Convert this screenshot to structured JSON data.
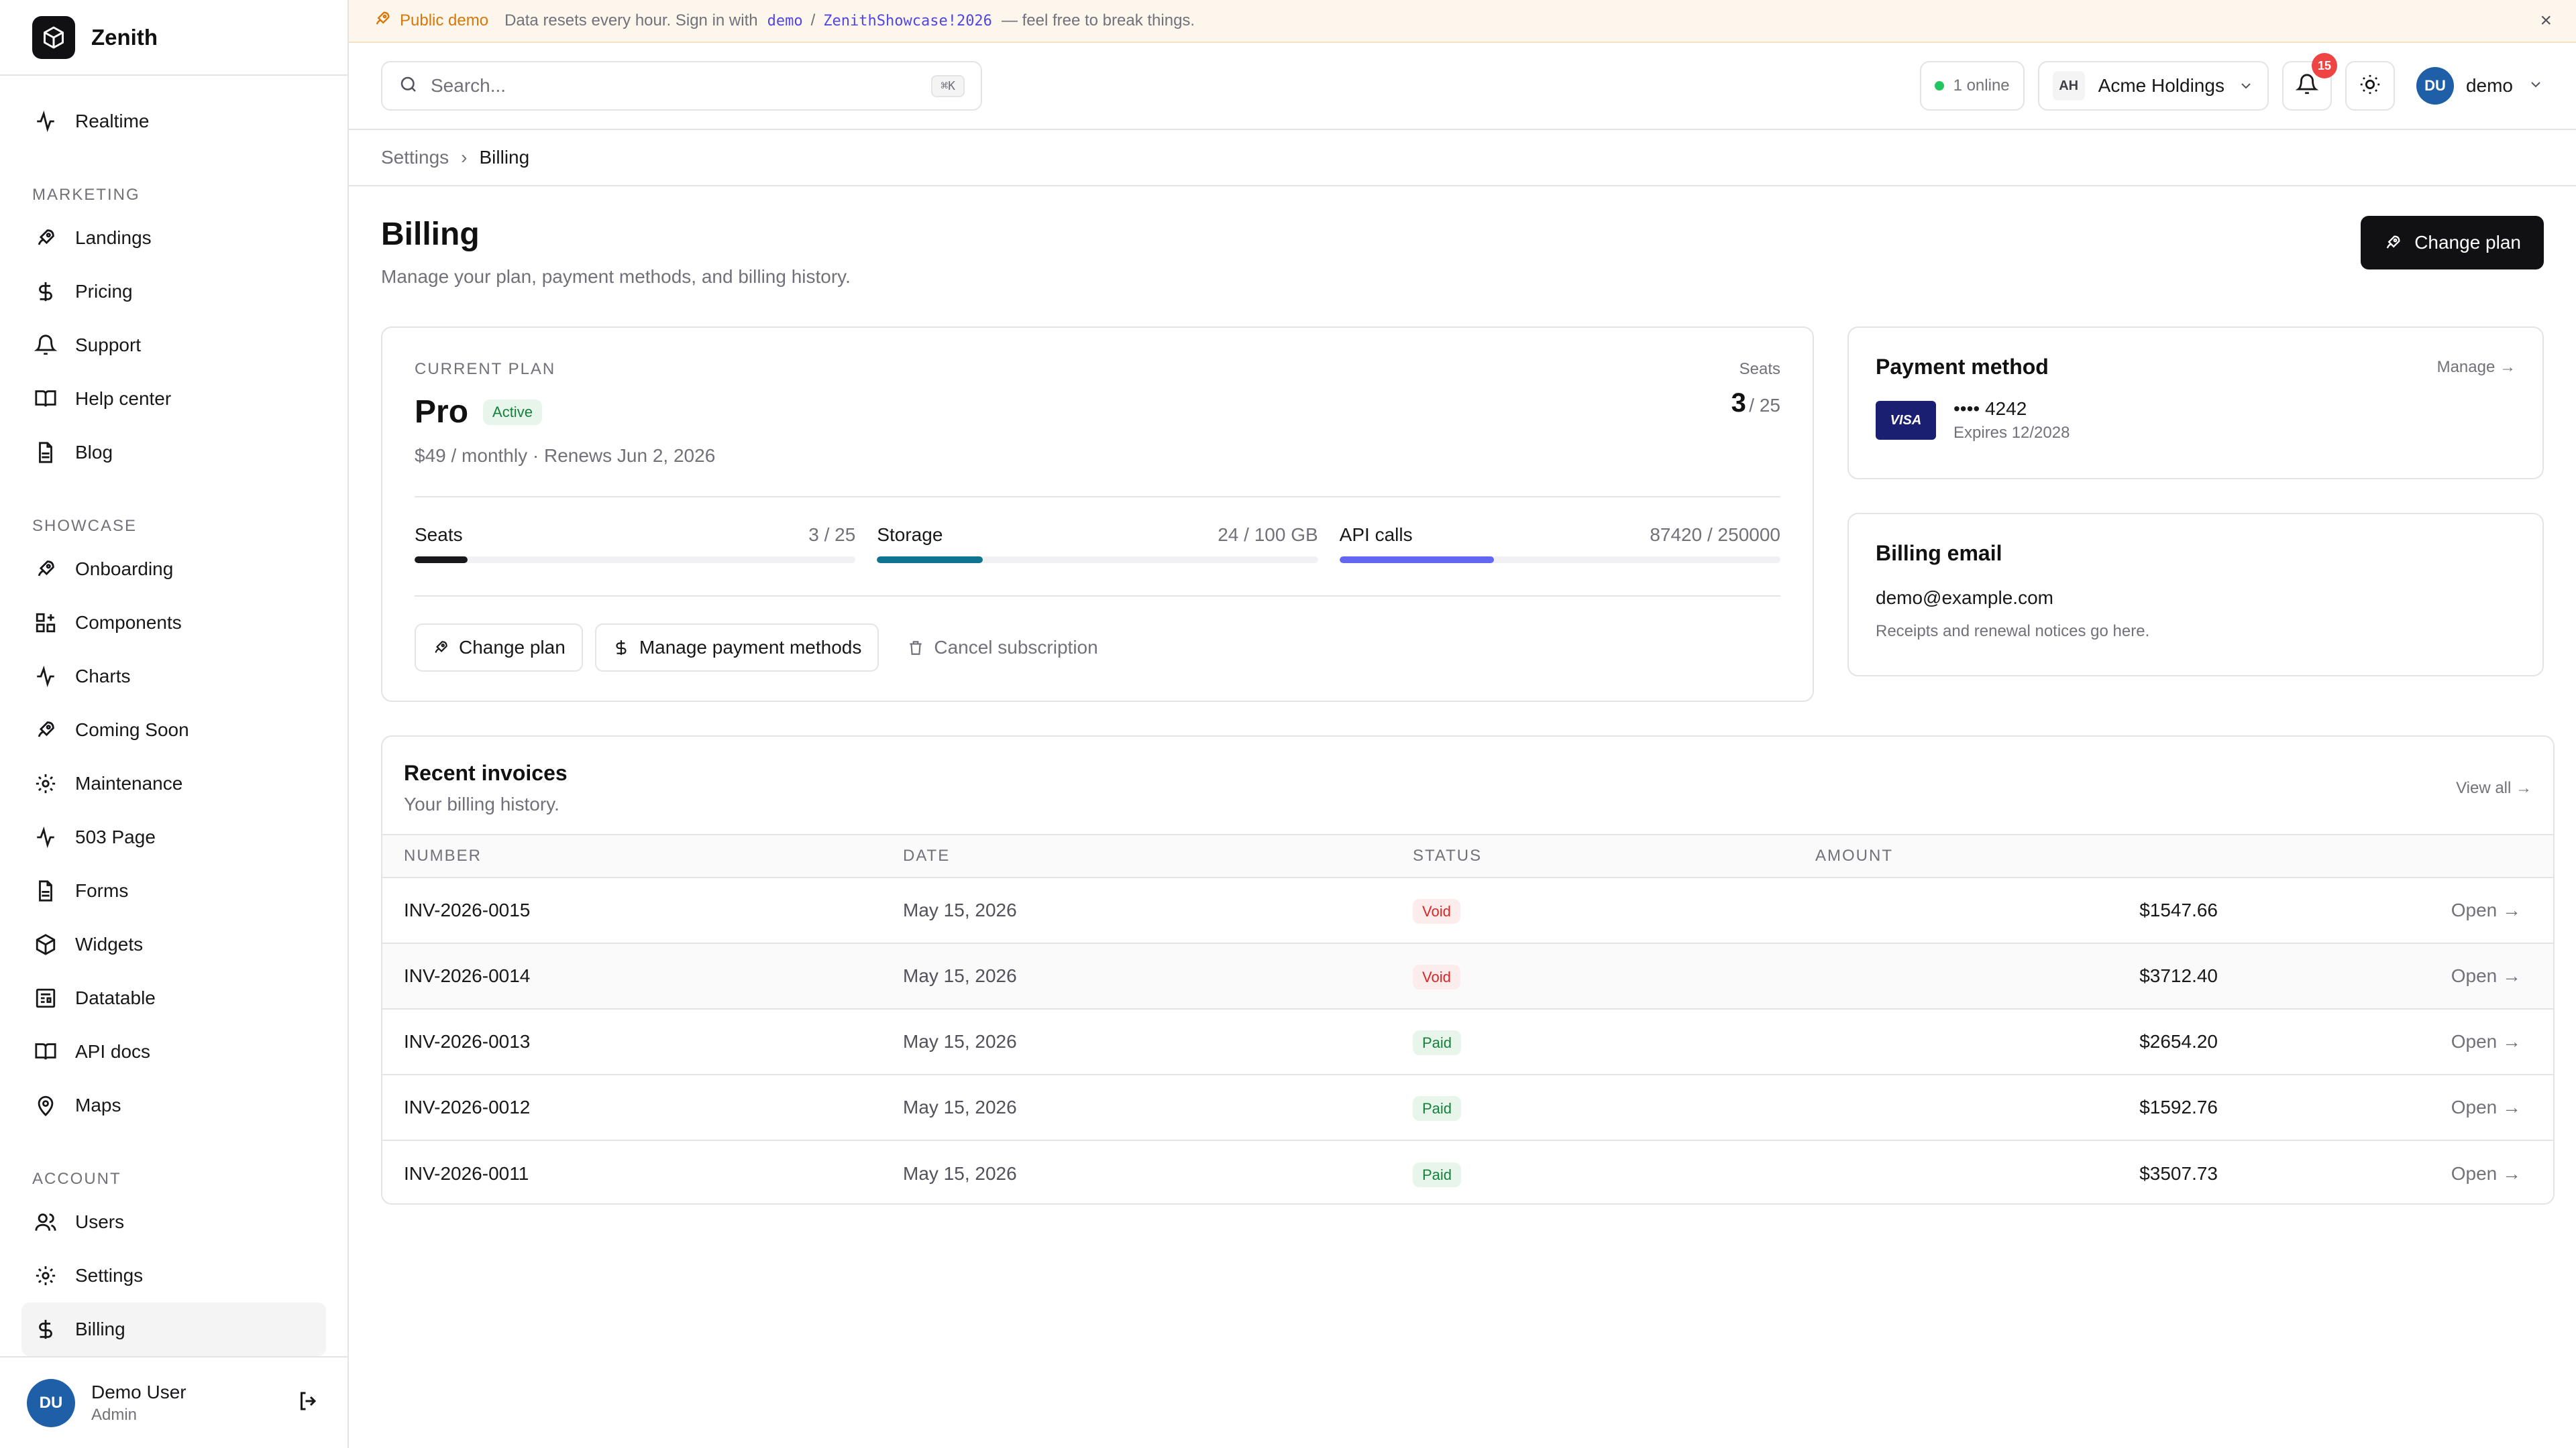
{
  "app": {
    "name": "Zenith"
  },
  "banner": {
    "tag": "Public demo",
    "text_before": "Data resets every hour. Sign in with",
    "username": "demo",
    "slash": "/",
    "password": "ZenithShowcase!2026",
    "text_after": "— feel free to break things.",
    "close": "×"
  },
  "sidebar": {
    "realtime": "Realtime",
    "sections": {
      "marketing": "MARKETING",
      "showcase": "SHOWCASE",
      "account": "ACCOUNT"
    },
    "marketing_items": [
      "Landings",
      "Pricing",
      "Support",
      "Help center",
      "Blog"
    ],
    "showcase_items": [
      "Onboarding",
      "Components",
      "Charts",
      "Coming Soon",
      "Maintenance",
      "503 Page",
      "Forms",
      "Widgets",
      "Datatable",
      "API docs",
      "Maps"
    ],
    "account_items": [
      "Users",
      "Settings",
      "Billing"
    ],
    "user": {
      "initials": "DU",
      "name": "Demo User",
      "role": "Admin"
    }
  },
  "topbar": {
    "search_placeholder": "Search...",
    "search_kbd": "⌘K",
    "online": "1 online",
    "org_initials": "AH",
    "org_name": "Acme Holdings",
    "notifications": "15",
    "user_initials": "DU",
    "user_name": "demo"
  },
  "breadcrumb": {
    "parent": "Settings",
    "sep": "›",
    "current": "Billing"
  },
  "page": {
    "title": "Billing",
    "subtitle": "Manage your plan, payment methods, and billing history.",
    "change_plan": "Change plan"
  },
  "plan": {
    "label": "CURRENT PLAN",
    "name": "Pro",
    "status": "Active",
    "price": "$49 / monthly · Renews Jun 2, 2026",
    "seats_label": "Seats",
    "seats_used": "3",
    "seats_total": "/ 25",
    "meters": [
      {
        "label": "Seats",
        "value": "3 / 25",
        "fraction": 0.12,
        "color": "#18181b"
      },
      {
        "label": "Storage",
        "value": "24 / 100 GB",
        "fraction": 0.24,
        "color": "#0e7490"
      },
      {
        "label": "API calls",
        "value": "87420 / 250000",
        "fraction": 0.35,
        "color": "#6366f1"
      }
    ],
    "actions": {
      "change_plan": "Change plan",
      "manage_payment": "Manage payment methods",
      "cancel": "Cancel subscription"
    }
  },
  "payment": {
    "title": "Payment method",
    "manage": "Manage →",
    "brand": "VISA",
    "number": "•••• 4242",
    "expires": "Expires 12/2028"
  },
  "billing_email": {
    "title": "Billing email",
    "email": "demo@example.com",
    "note": "Receipts and renewal notices go here."
  },
  "invoices": {
    "title": "Recent invoices",
    "subtitle": "Your billing history.",
    "view_all": "View all →",
    "columns": [
      "NUMBER",
      "DATE",
      "STATUS",
      "AMOUNT"
    ],
    "rows": [
      {
        "number": "INV-2026-0015",
        "date": "May 15, 2026",
        "status": "Void",
        "amount": "$1547.66",
        "action": "Open →"
      },
      {
        "number": "INV-2026-0014",
        "date": "May 15, 2026",
        "status": "Void",
        "amount": "$3712.40",
        "action": "Open →"
      },
      {
        "number": "INV-2026-0013",
        "date": "May 15, 2026",
        "status": "Paid",
        "amount": "$2654.20",
        "action": "Open →"
      },
      {
        "number": "INV-2026-0012",
        "date": "May 15, 2026",
        "status": "Paid",
        "amount": "$1592.76",
        "action": "Open →"
      },
      {
        "number": "INV-2026-0011",
        "date": "May 15, 2026",
        "status": "Paid",
        "amount": "$3507.73",
        "action": "Open →"
      }
    ]
  },
  "colors": {
    "accent_dark": "#111113",
    "active_green": "#15803d",
    "void_red": "#dc2626",
    "notif_red": "#ef4444",
    "avatar_blue": "#1e5fa8"
  }
}
